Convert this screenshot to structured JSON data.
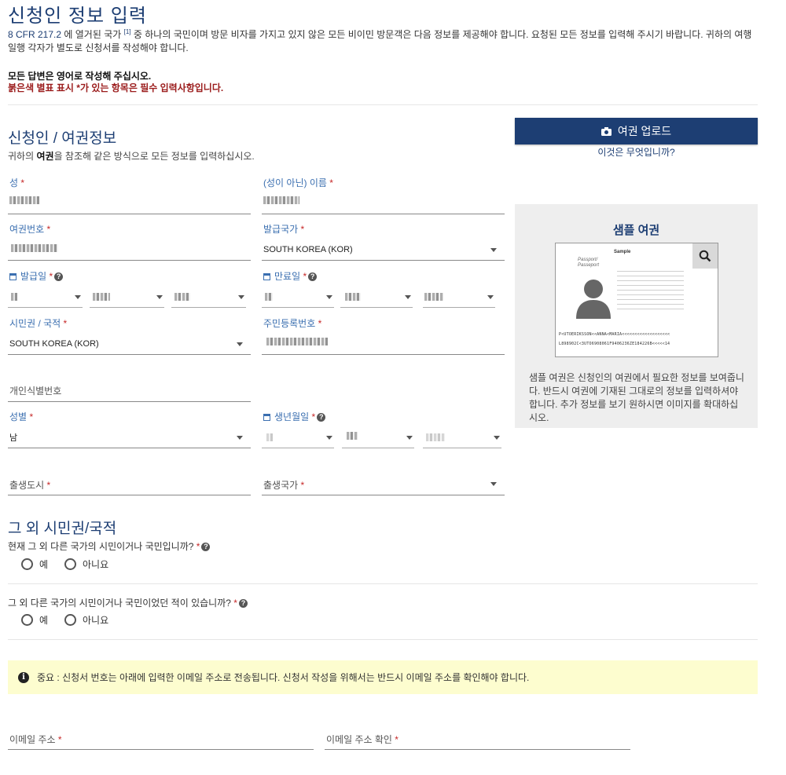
{
  "page": {
    "title": "신청인 정보 입력",
    "intro_link": "8 CFR 217.2",
    "intro_text_1": " 에 열거된 국가 ",
    "intro_sup": "[1]",
    "intro_text_2": " 중 하나의 국민이며 방문 비자를 가지고 있지 않은 모든 비이민 방문객은 다음 정보를 제공해야 합니다. 요청된 모든 정보를 입력해 주시기 바랍니다. 귀하의 여행 일행 각자가 별도로 신청서를 작성해야 합니다.",
    "note_english": "모든 답변은 영어로 작성해 주십시오.",
    "note_required": "붉은색 별표 표시 *가 있는 항목은 필수 입력사항입니다."
  },
  "section_applicant": {
    "heading": "신청인 / 여권정보",
    "sub_1": "귀하의 ",
    "sub_bold": "여권",
    "sub_2": "을 참조해 같은 방식으로 모든 정보를 입력하십시오."
  },
  "fields": {
    "surname_label": "성",
    "given_label": "(성이 아닌) 이름",
    "passport_no_label": "여권번호",
    "issuing_country_label": "발급국가",
    "issuing_country_value": "SOUTH KOREA (KOR)",
    "issue_date_label": "발급일",
    "expiry_date_label": "만료일",
    "citizenship_label": "시민권 / 국적",
    "citizenship_value": "SOUTH KOREA (KOR)",
    "national_id_label": "주민등록번호",
    "personal_id_label": "개인식별번호",
    "sex_label": "성별",
    "sex_value": "남",
    "dob_label": "생년월일",
    "birth_city_label": "출생도시",
    "birth_country_label": "출생국가",
    "required_mark": "*",
    "help_mark": "?"
  },
  "sidebar": {
    "upload_label": "여권 업로드",
    "what_is_this": "이것은 무엇입니까?",
    "sample_title": "샘플 여권",
    "sample_description": "샘플 여권은 신청인의 여권에서 필요한 정보를 보여줍니다. 반드시 여권에 기재된 그대로의 정보를 입력하셔야 합니다. 추가 정보를 보기 원하시면 이미지를 확대하십시오.",
    "passport_sample_label": "Sample",
    "passport_word": "Passport/ Passeport",
    "passport_mrz_1": "P<UTOERIKSSON<<ANNA<MARIA<<<<<<<<<<<<<<<<<<<",
    "passport_mrz_2": "L898902C<3UTO6908061F9406236ZE184226B<<<<<14"
  },
  "section_other": {
    "heading": "그 외 시민권/국적",
    "q1": "현재 그 외 다른 국가의 시민이거나 국민입니까?",
    "q2": "그 외 다른 국가의 시민이거나 국민이었던 적이 있습니까?",
    "yes": "예",
    "no": "아니요"
  },
  "notice": {
    "icon": "i",
    "text": "중요 : 신청서 번호는 아래에 입력한 이메일 주소로 전송됩니다. 신청서 작성을 위해서는 반드시 이메일 주소를 확인해야 합니다."
  },
  "email": {
    "email_label": "이메일 주소",
    "confirm_label": "이메일 주소 확인"
  }
}
